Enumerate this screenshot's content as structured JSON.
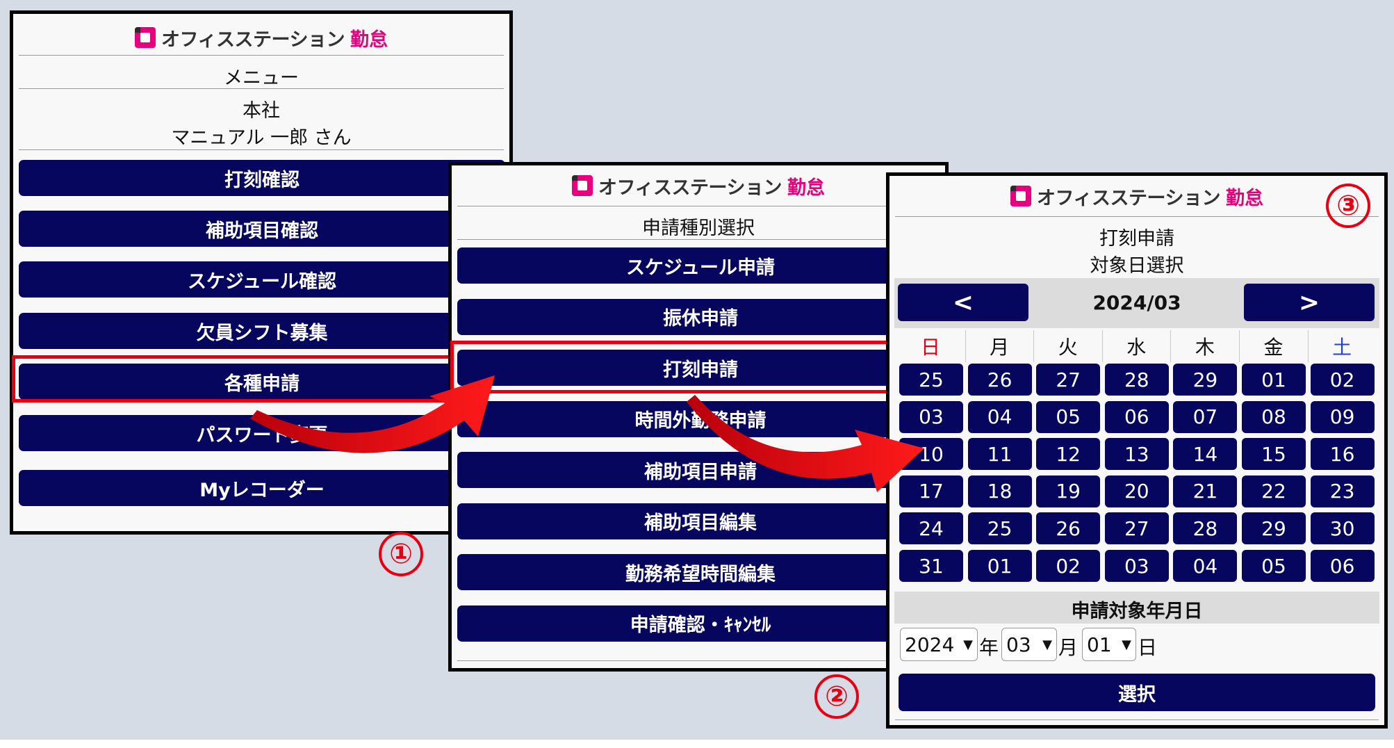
{
  "logo": {
    "name": "オフィスステーション",
    "brand": "勤怠"
  },
  "panel1": {
    "title": "メニュー",
    "company": "本社",
    "user": "マニュアル 一郎 さん",
    "buttons": [
      "打刻確認",
      "補助項目確認",
      "スケジュール確認",
      "欠員シフト募集",
      "各種申請",
      "パスワード変更",
      "Myレコーダー"
    ],
    "step": "①"
  },
  "panel2": {
    "title": "申請種別選択",
    "buttons": [
      "スケジュール申請",
      "振休申請",
      "打刻申請",
      "時間外勤務申請",
      "補助項目申請",
      "補助項目編集",
      "勤務希望時間編集",
      "申請確認・ｷｬﾝｾﾙ"
    ],
    "step": "②"
  },
  "panel3": {
    "title1": "打刻申請",
    "title2": "対象日選択",
    "step": "③",
    "calendar": {
      "prev": "<",
      "next": ">",
      "month": "2024/03",
      "weekdays": [
        "日",
        "月",
        "火",
        "水",
        "木",
        "金",
        "土"
      ],
      "weeks": [
        [
          "25",
          "26",
          "27",
          "28",
          "29",
          "01",
          "02"
        ],
        [
          "03",
          "04",
          "05",
          "06",
          "07",
          "08",
          "09"
        ],
        [
          "10",
          "11",
          "12",
          "13",
          "14",
          "15",
          "16"
        ],
        [
          "17",
          "18",
          "19",
          "20",
          "21",
          "22",
          "23"
        ],
        [
          "24",
          "25",
          "26",
          "27",
          "28",
          "29",
          "30"
        ],
        [
          "31",
          "01",
          "02",
          "03",
          "04",
          "05",
          "06"
        ]
      ]
    },
    "target_label": "申請対象年月日",
    "year": "2024",
    "year_unit": "年",
    "month": "03",
    "month_unit": "月",
    "day": "01",
    "day_unit": "日",
    "select_button": "選択"
  },
  "colors": {
    "button": "#06065e",
    "highlight": "#e60012",
    "brand": "#e6007e"
  }
}
